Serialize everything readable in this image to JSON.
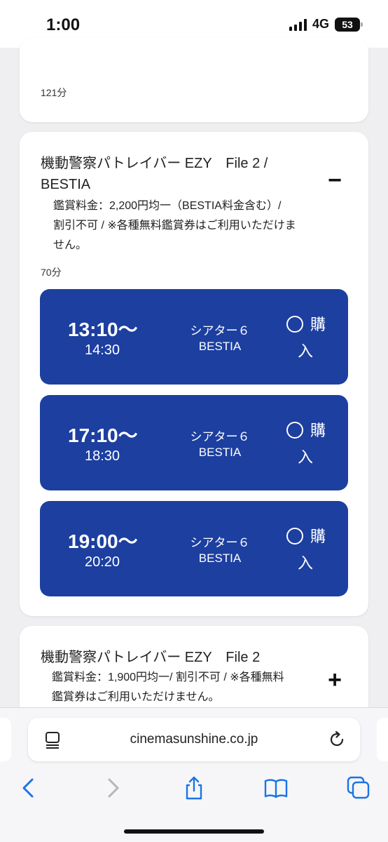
{
  "status_bar": {
    "time": "1:00",
    "network": "4G",
    "battery": "53"
  },
  "top_card": {
    "duration": "121分"
  },
  "movie1": {
    "title_line1": "機動警察パトレイバー EZY　File 2 /",
    "title_line2": "BESTIA",
    "price_note_line1": "鑑賞料金：2,200円均一（BESTIA料金含む）/",
    "price_note_line2": "割引不可 / ※各種無料鑑賞券はご利用いただけま",
    "price_note_line3": "せん。",
    "duration": "70分",
    "toggle": "−",
    "showtimes": [
      {
        "start": "13:10〜",
        "end": "14:30",
        "theater": "シアター６",
        "screen": "BESTIA",
        "buy_line1": "購",
        "buy_line2": "入"
      },
      {
        "start": "17:10〜",
        "end": "18:30",
        "theater": "シアター６",
        "screen": "BESTIA",
        "buy_line1": "購",
        "buy_line2": "入"
      },
      {
        "start": "19:00〜",
        "end": "20:20",
        "theater": "シアター６",
        "screen": "BESTIA",
        "buy_line1": "購",
        "buy_line2": "入"
      }
    ]
  },
  "movie2": {
    "title": "機動警察パトレイバー EZY　File 2",
    "price_note_line1": "鑑賞料金：1,900円均一/ 割引不可 / ※各種無料",
    "price_note_line2": "鑑賞券はご利用いただけません。",
    "toggle": "+"
  },
  "browser": {
    "url": "cinemasunshine.co.jp"
  },
  "colors": {
    "showtime_bg": "#1c3fa0",
    "accent": "#1a73e8"
  },
  "icons": [
    "page-menu-icon",
    "reload-icon",
    "back-icon",
    "forward-icon",
    "share-icon",
    "bookmarks-icon",
    "tabs-icon"
  ]
}
